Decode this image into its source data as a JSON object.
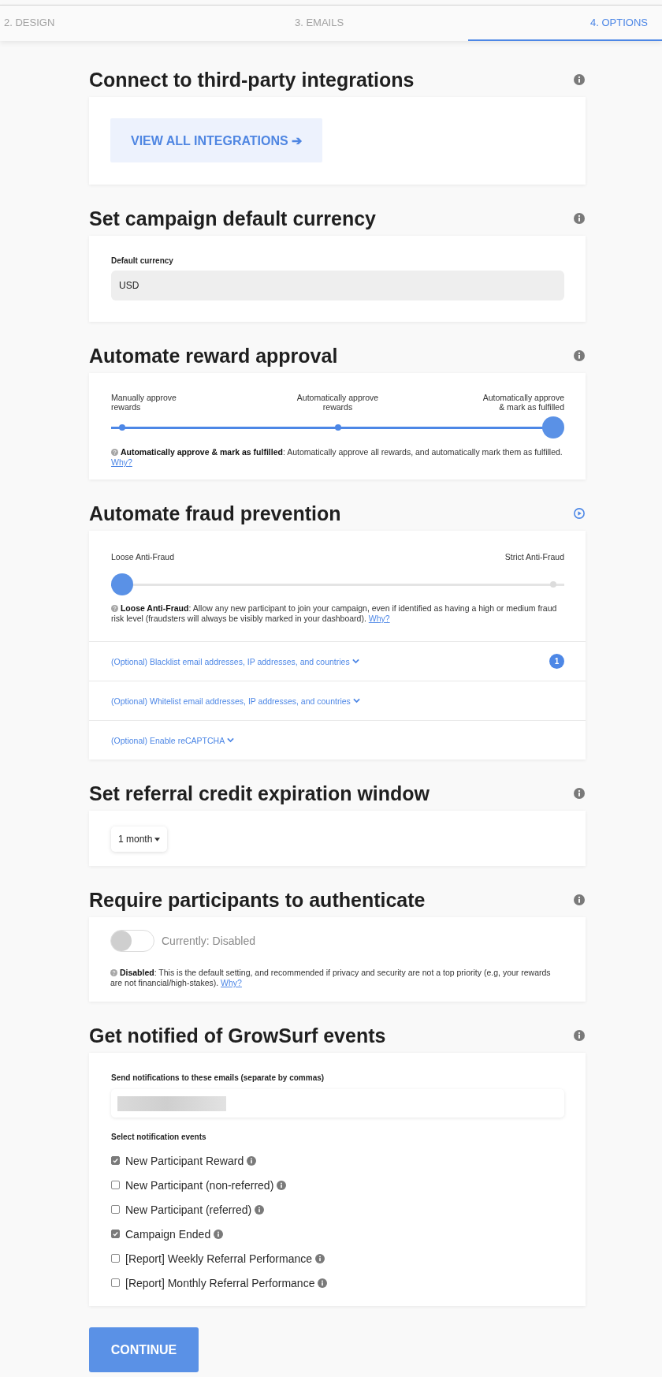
{
  "tabs": [
    {
      "label": "2. DESIGN",
      "selected": false
    },
    {
      "label": "3. EMAILS",
      "selected": false
    },
    {
      "label": "4. OPTIONS",
      "selected": true
    }
  ],
  "integrations": {
    "title": "Connect to third-party integrations",
    "button": "VIEW ALL INTEGRATIONS ➔"
  },
  "currency": {
    "title": "Set campaign default currency",
    "label": "Default currency",
    "value": "USD"
  },
  "reward_approval": {
    "title": "Automate reward approval",
    "stops": [
      {
        "label": "Manually approve rewards",
        "selected": false
      },
      {
        "label": "Automatically approve rewards",
        "selected": false
      },
      {
        "label": "Automatically approve & mark as fulfilled",
        "selected": true
      }
    ],
    "help": "**Automatically approve & mark as fulfilled**: Automatically approve all rewards, and automatically mark them as fulfilled.",
    "link": "Why?"
  },
  "fraud_prevention": {
    "title": "Automate fraud prevention",
    "stops": [
      {
        "label": "Loose Anti-Fraud",
        "selected": true
      },
      {
        "label": "Strict Anti-Fraud",
        "selected": false
      }
    ],
    "help": "**Loose Anti-Fraud**: Allow any new participant to join your campaign, even if identified as having a high or medium fraud risk level (fraudsters will always be visibly marked in your dashboard).",
    "link": "Why?",
    "options": [
      {
        "label": "(Optional) Blacklist email addresses, IP addresses, and countries",
        "expanded": false,
        "badge": "1"
      },
      {
        "label": "(Optional) Whitelist email addresses, IP addresses, and countries",
        "expanded": false
      },
      {
        "label": "(Optional) Enable reCAPTCHA",
        "expanded": false
      }
    ]
  },
  "credit_expiration": {
    "title": "Set referral credit expiration window",
    "value": "1 month"
  },
  "authentication": {
    "title": "Require participants to authenticate",
    "on": false,
    "status": "Currently: Disabled",
    "help": "**Disabled**: This is the default setting, and recommended if privacy and security are not a top priority (e.g, your rewards are not financial/high-stakes).",
    "link": "Why?"
  },
  "notifications": {
    "title": "Get notified of GrowSurf events",
    "email_label": "Send notifications to these emails (separate by commas)",
    "events_label": "Select notification events",
    "events": [
      {
        "label": "New Participant Reward",
        "checked": true
      },
      {
        "label": "New Participant (non-referred)",
        "checked": false
      },
      {
        "label": "New Participant (referred)",
        "checked": false
      },
      {
        "label": "Campaign Ended",
        "checked": true
      },
      {
        "label": "[Report] Weekly Referral Performance",
        "checked": false
      },
      {
        "label": "[Report] Monthly Referral Performance",
        "checked": false
      }
    ]
  },
  "continue_button": "CONTINUE"
}
